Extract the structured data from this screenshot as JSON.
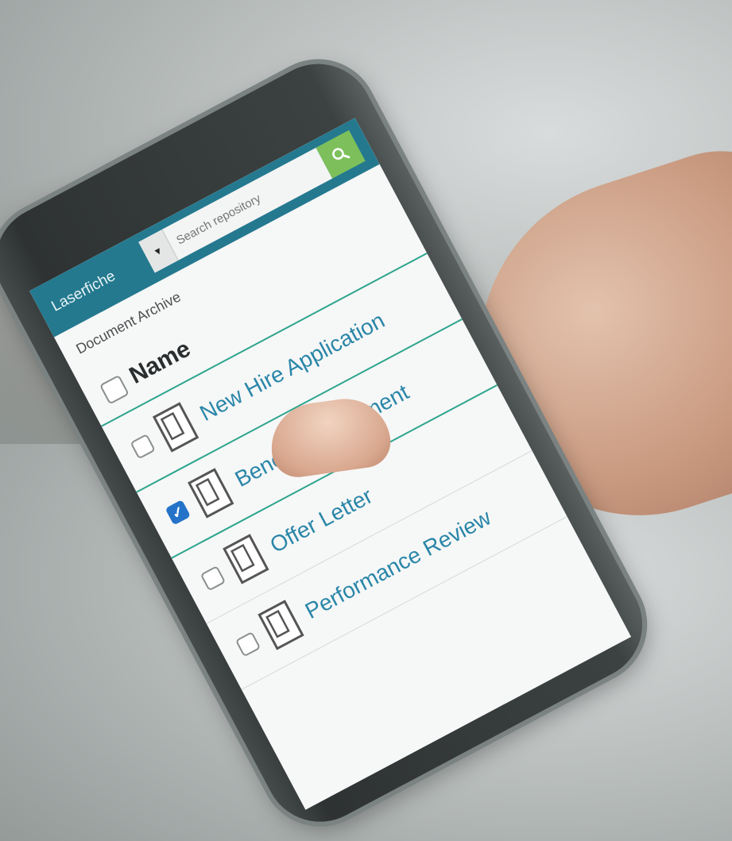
{
  "app": {
    "brand": "Laserfiche"
  },
  "search": {
    "placeholder": "Search repository",
    "dropdown_glyph": "▼"
  },
  "breadcrumb": "Document Archive",
  "list": {
    "header": "Name",
    "items": [
      {
        "label": "New Hire Application",
        "checked": false
      },
      {
        "label": "Benefits Enrollment",
        "checked": true
      },
      {
        "label": "Offer Letter",
        "checked": false
      },
      {
        "label": "Performance Review",
        "checked": false
      }
    ]
  },
  "colors": {
    "accent": "#24798f",
    "search_button": "#7dc05b",
    "divider": "#2ca58d",
    "link": "#2a86a8",
    "checkbox_checked": "#2473c8"
  },
  "icons": {
    "search": "search-icon",
    "document": "document-icon",
    "dropdown": "chevron-down-icon"
  }
}
